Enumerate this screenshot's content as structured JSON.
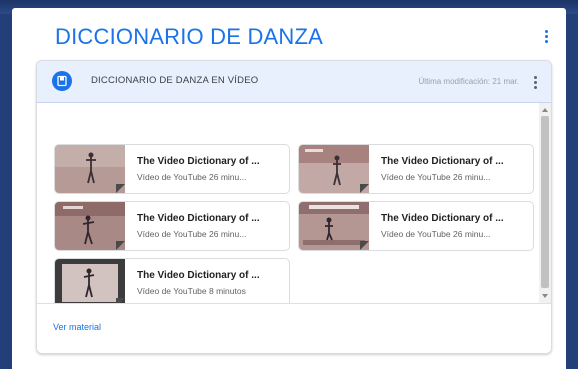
{
  "page": {
    "title": "DICCIONARIO DE DANZA"
  },
  "card": {
    "title": "DICCIONARIO DE DANZA EN VÍDEO",
    "modified": "Última modificación: 21 mar."
  },
  "items": [
    {
      "title": "The Video Dictionary of ...",
      "subtitle": "Vídeo de YouTube  26 minu..."
    },
    {
      "title": "The Video Dictionary of ...",
      "subtitle": "Vídeo de YouTube  26 minu..."
    },
    {
      "title": "The Video Dictionary of ...",
      "subtitle": "Vídeo de YouTube  26 minu..."
    },
    {
      "title": "The Video Dictionary of ...",
      "subtitle": "Vídeo de YouTube  26 minu..."
    },
    {
      "title": "The Video Dictionary of ...",
      "subtitle": "Vídeo de YouTube  8 minutos"
    }
  ],
  "footer": {
    "link": "Ver material"
  },
  "icons": {
    "page_menu": "more-vert-icon",
    "card_menu": "more-vert-icon",
    "folder": "folder-icon"
  },
  "colors": {
    "accent": "#1a73e8",
    "header_bg": "#e8f0fe",
    "backdrop": "#233f7a"
  }
}
